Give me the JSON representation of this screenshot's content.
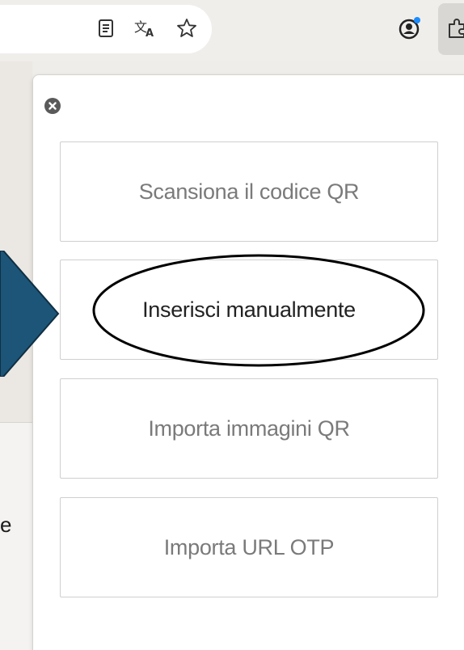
{
  "browser_toolbar": {
    "icons": [
      "reader-view-icon",
      "translate-icon",
      "bookmark-star-icon",
      "profile-icon",
      "extensions-icon"
    ]
  },
  "background_page": {
    "text_fragment": "e"
  },
  "popup": {
    "buttons": [
      {
        "label": "Scansiona il codice QR"
      },
      {
        "label": "Inserisci manualmente"
      },
      {
        "label": "Importa immagini QR"
      },
      {
        "label": "Importa URL OTP"
      }
    ]
  },
  "annotations": {
    "arrow_color": "#1c5577",
    "circle_color": "#000000",
    "highlighted_button": "Inserisci manualmente"
  }
}
